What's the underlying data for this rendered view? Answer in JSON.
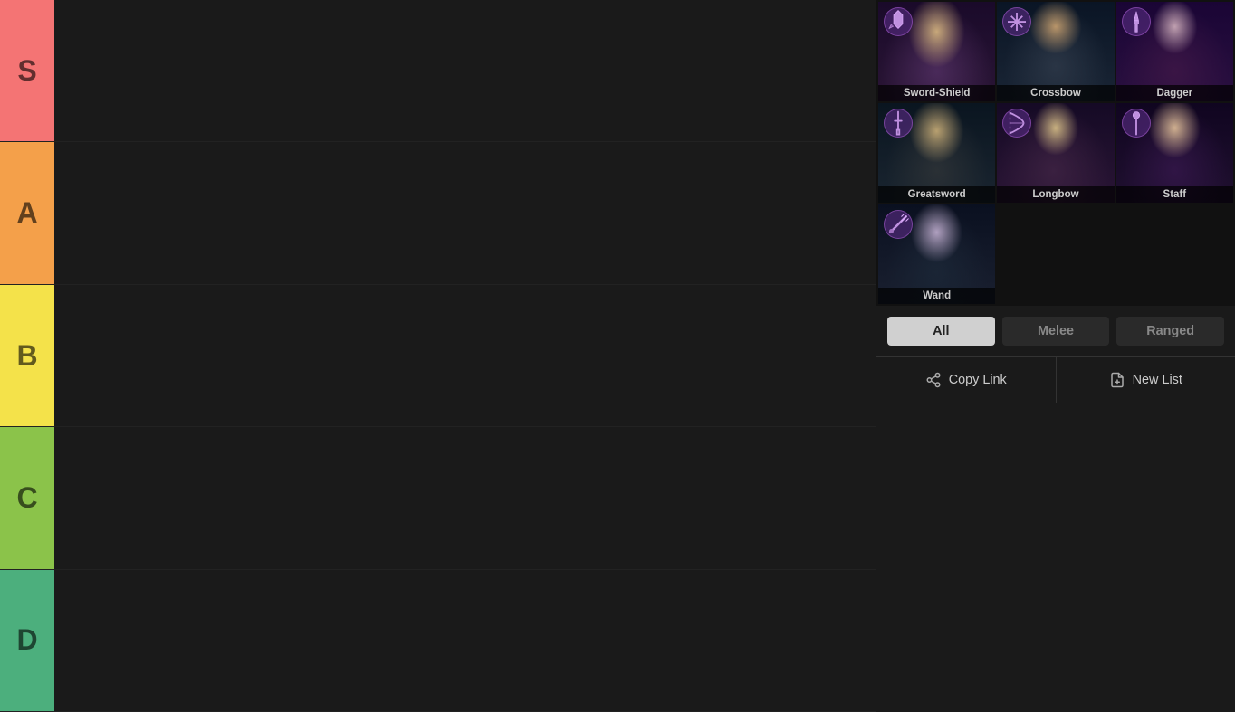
{
  "tiers": [
    {
      "id": "s",
      "label": "S",
      "color": "#f47474"
    },
    {
      "id": "a",
      "label": "A",
      "color": "#f4a04a"
    },
    {
      "id": "b",
      "label": "B",
      "color": "#f4e24a"
    },
    {
      "id": "c",
      "label": "C",
      "color": "#8bc34a"
    },
    {
      "id": "d",
      "label": "D",
      "color": "#4caf7d"
    }
  ],
  "weapons": [
    {
      "id": "sword-shield",
      "name": "Sword-Shield",
      "icon": "🛡"
    },
    {
      "id": "crossbow",
      "name": "Crossbow",
      "icon": "✝"
    },
    {
      "id": "dagger",
      "name": "Dagger",
      "icon": "🗡"
    },
    {
      "id": "greatsword",
      "name": "Greatsword",
      "icon": "⚔"
    },
    {
      "id": "longbow",
      "name": "Longbow",
      "icon": "🏹"
    },
    {
      "id": "staff",
      "name": "Staff",
      "icon": "✦"
    },
    {
      "id": "wand",
      "name": "Wand",
      "icon": "✧"
    }
  ],
  "filters": [
    {
      "id": "all",
      "label": "All",
      "active": true
    },
    {
      "id": "melee",
      "label": "Melee",
      "active": false
    },
    {
      "id": "ranged",
      "label": "Ranged",
      "active": false
    }
  ],
  "actions": [
    {
      "id": "copy-link",
      "label": "Copy Link",
      "icon": "share"
    },
    {
      "id": "new-list",
      "label": "New List",
      "icon": "doc"
    }
  ]
}
